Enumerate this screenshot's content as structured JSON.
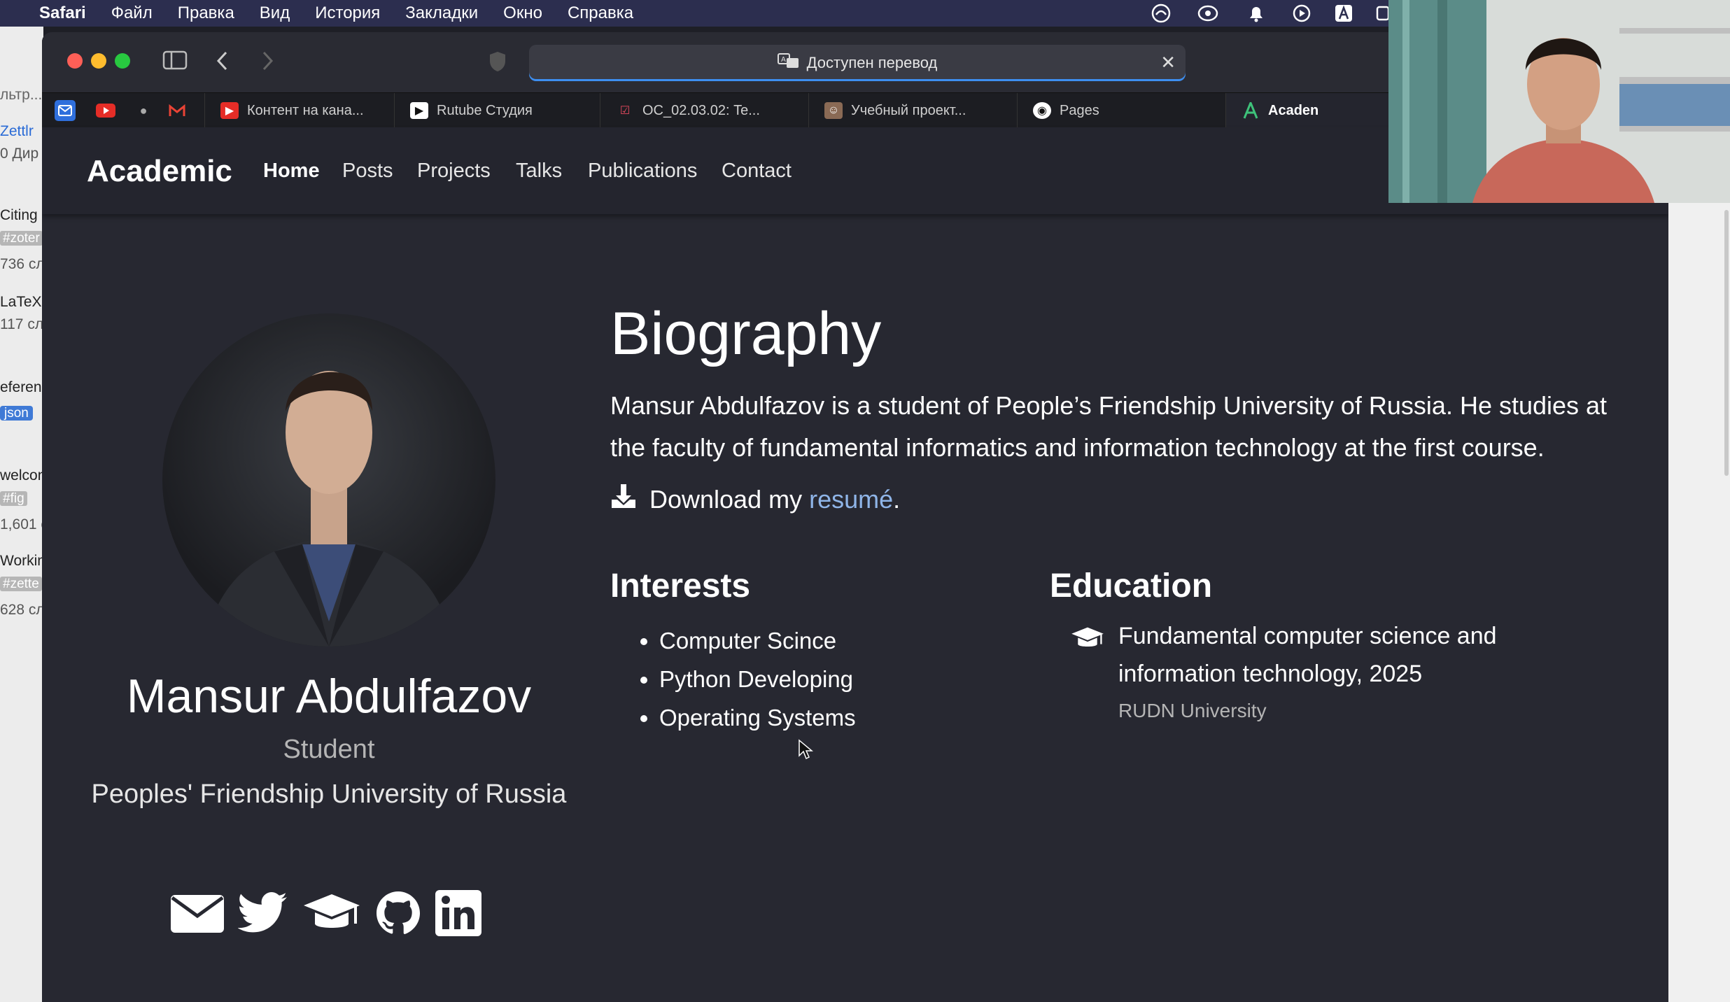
{
  "menubar": {
    "app": "Safari",
    "items": [
      "Файл",
      "Правка",
      "Вид",
      "История",
      "Закладки",
      "Окно",
      "Справка"
    ]
  },
  "left_app": {
    "lines": [
      "льтр...",
      "Zettlr",
      "0 Дир",
      "Citing",
      "#zoter",
      "736 сл",
      "LaTeX",
      "117 сл",
      "eferen",
      "json",
      "welcon",
      "#fig",
      "1,601 с",
      "Workin",
      "#zette",
      "628 сл"
    ]
  },
  "browser": {
    "address_text": "Доступен перевод",
    "tabs": [
      "Контент на кана...",
      "Rutube Студия",
      "ОС_02.03.02: Te...",
      "Учебный проект...",
      "Pages",
      "Acaden"
    ]
  },
  "site": {
    "brand": "Academic",
    "nav": [
      "Home",
      "Posts",
      "Projects",
      "Talks",
      "Publications",
      "Contact"
    ],
    "profile": {
      "name": "Mansur Abdulfazov",
      "role": "Student",
      "organization": "Peoples' Friendship University of Russia"
    },
    "biography": {
      "title": "Biography",
      "text": "Mansur Abdulfazov is a student of People’s Friendship University of Russia. He studies at the faculty of fundamental informatics and information technology at the first course.",
      "download_prefix": "Download my ",
      "download_link": "resumé",
      "download_suffix": "."
    },
    "interests": {
      "title": "Interests",
      "items": [
        "Computer Scince",
        "Python Developing",
        "Operating Systems"
      ]
    },
    "education": {
      "title": "Education",
      "degree": "Fundamental computer science and information technology, 2025",
      "institution": "RUDN University"
    },
    "social_icons": [
      "envelope-icon",
      "twitter-icon",
      "graduation-cap-icon",
      "github-icon",
      "linkedin-icon"
    ]
  },
  "colors": {
    "page_bg": "#272831",
    "nav_bg": "#24252e",
    "link": "#8fb5e8",
    "menubar": "#2c2e4f"
  }
}
